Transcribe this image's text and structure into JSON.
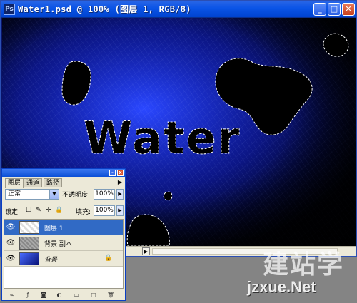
{
  "window": {
    "title": "Water1.psd @ 100% (图层 1, RGB/8)",
    "app_icon_letter": "Ps",
    "minimize_glyph": "_",
    "maximize_glyph": "□",
    "close_glyph": "✕"
  },
  "canvas": {
    "text": "Water",
    "accent_color": "#1a2ed0"
  },
  "scroll": {
    "right_arrow": "▶"
  },
  "layers_panel": {
    "tabs": [
      "图层",
      "通道",
      "路径"
    ],
    "menu_arrow": "▶",
    "minimize_glyph": "-",
    "close_glyph": "x",
    "blend_mode": "正常",
    "blend_arrow": "▼",
    "opacity_label": "不透明度:",
    "opacity_value": "100%",
    "lock_label": "锁定:",
    "lock_icons": [
      "☐",
      "✎",
      "✛",
      "🔒"
    ],
    "fill_label": "填充:",
    "fill_value": "100%",
    "step_arrow": "▶",
    "eye_glyph": "👁",
    "layers": [
      {
        "name": "图层 1",
        "selected": true
      },
      {
        "name": "背景 副本",
        "selected": false
      },
      {
        "name": "背景",
        "selected": false,
        "locked": true
      }
    ],
    "background_lock_glyph": "🔒",
    "footer_icons": [
      "∞",
      "ƒ",
      "◙",
      "◐",
      "▭",
      "▢",
      "🗑"
    ]
  },
  "watermark": {
    "chinese": "建站学",
    "english": "jzxue.Net"
  }
}
